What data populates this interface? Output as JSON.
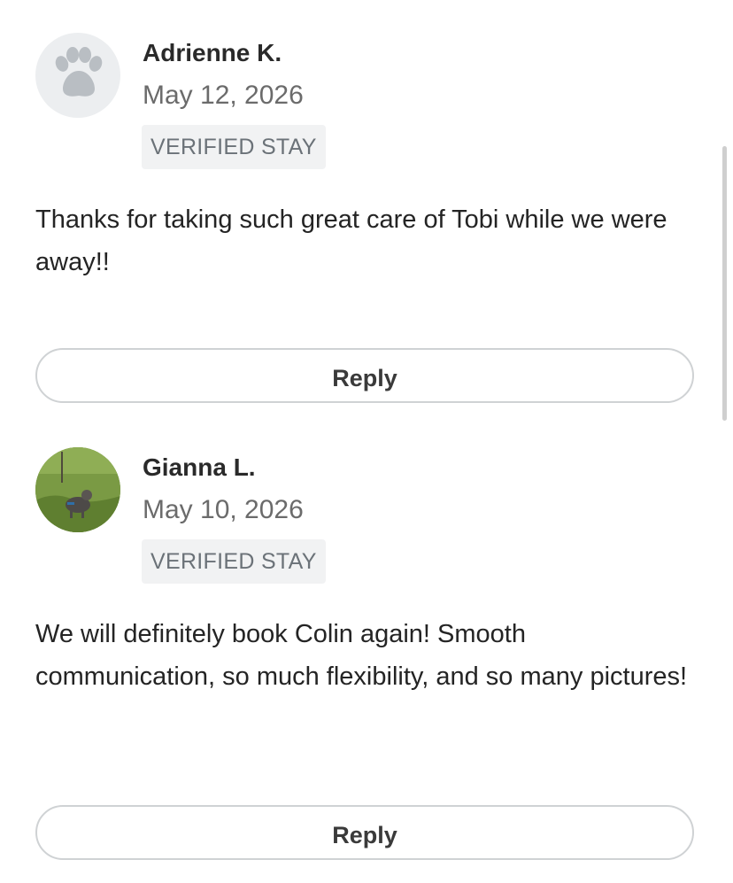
{
  "reviews": [
    {
      "reviewer_name": "Adrienne K.",
      "date": "May 12, 2026",
      "badge": "VERIFIED STAY",
      "avatar": "paw-placeholder-icon",
      "text": "Thanks for taking such great care of Tobi while we were away!!",
      "reply_label": "Reply"
    },
    {
      "reviewer_name": "Gianna L.",
      "date": "May 10, 2026",
      "badge": "VERIFIED STAY",
      "avatar": "dog-photo",
      "text": "We will definitely book Colin again! Smooth communication, so much flexibility, and so many pictures!",
      "reply_label": "Reply"
    }
  ],
  "colors": {
    "badge_background": "#f1f2f3",
    "button_border": "#cfd2d4",
    "text_primary": "#242424",
    "text_secondary": "#6b6b6b"
  }
}
